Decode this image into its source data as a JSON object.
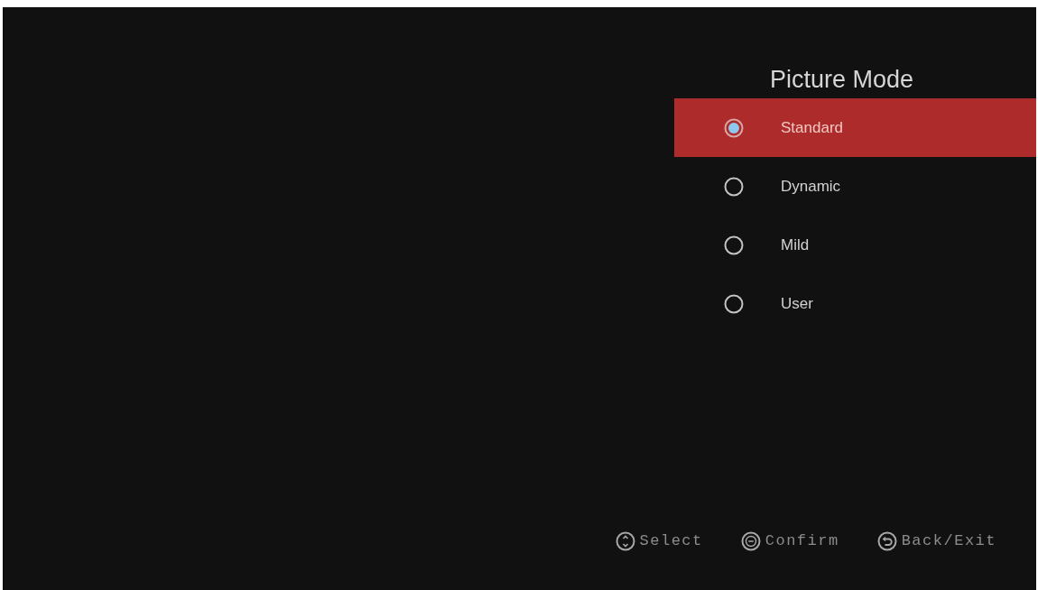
{
  "title": "Picture Mode",
  "options": [
    {
      "label": "Standard",
      "selected": true
    },
    {
      "label": "Dynamic",
      "selected": false
    },
    {
      "label": "Mild",
      "selected": false
    },
    {
      "label": "User",
      "selected": false
    }
  ],
  "hints": [
    {
      "kind": "updown",
      "label": "Select"
    },
    {
      "kind": "ok",
      "label": "Confirm"
    },
    {
      "kind": "back",
      "label": "Back/Exit"
    }
  ]
}
